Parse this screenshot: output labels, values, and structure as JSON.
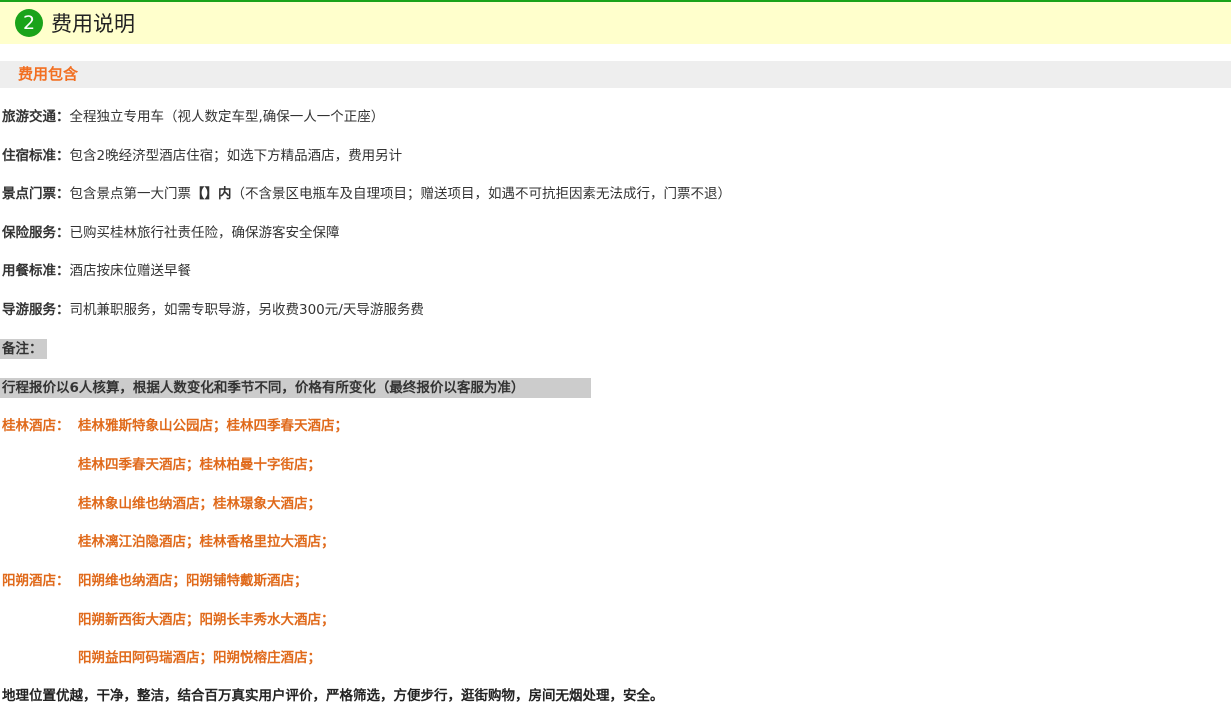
{
  "header": {
    "step_number": "2",
    "title": "费用说明"
  },
  "section": {
    "title": "费用包含"
  },
  "items": [
    {
      "label": "旅游交通：",
      "value": "全程独立专用车（视人数定车型,确保一人一个正座）"
    },
    {
      "label": "住宿标准：",
      "value": "包含2晚经济型酒店住宿；如选下方精品酒店，费用另计"
    },
    {
      "label": "景点门票：",
      "value_pre": "包含景点第一大门票",
      "value_bold": "【】内",
      "value_post": "（不含景区电瓶车及自理项目；赠送项目，如遇不可抗拒因素无法成行，门票不退）"
    },
    {
      "label": "保险服务：",
      "value": "已购买桂林旅行社责任险，确保游客安全保障"
    },
    {
      "label": "用餐标准：",
      "value": "酒店按床位赠送早餐"
    },
    {
      "label": "导游服务：",
      "value": "司机兼职服务，如需专职导游，另收费300元/天导游服务费"
    }
  ],
  "remarks": {
    "label": "备注：",
    "pricing_note": "行程报价以6人核算，根据人数变化和季节不同，价格有所变化（最终报价以客服为准）"
  },
  "hotels": {
    "guilin": {
      "label": "桂林酒店：",
      "lines": [
        "桂林雅斯特象山公园店；桂林四季春天酒店；",
        "桂林四季春天酒店；桂林柏曼十字街店；",
        "桂林象山维也纳酒店；桂林璟象大酒店；",
        "桂林漓江泊隐酒店；桂林香格里拉大酒店；"
      ]
    },
    "yangshuo": {
      "label": "阳朔酒店：",
      "lines": [
        "阳朔维也纳酒店；阳朔铺特戴斯酒店；",
        "阳朔新西街大酒店；阳朔长丰秀水大酒店；",
        "阳朔益田阿码瑞酒店；阳朔悦榕庄酒店；"
      ]
    }
  },
  "footer": {
    "text": "地理位置优越，干净，整洁，结合百万真实用户评价，严格筛选，方便步行，逛街购物，房间无烟处理，安全。"
  },
  "colors": {
    "green": "#1aa31a",
    "orange": "#f26f21",
    "header_bg": "#ffffcc",
    "section_bg": "#eeeeee",
    "note_bg": "#cccccc"
  }
}
